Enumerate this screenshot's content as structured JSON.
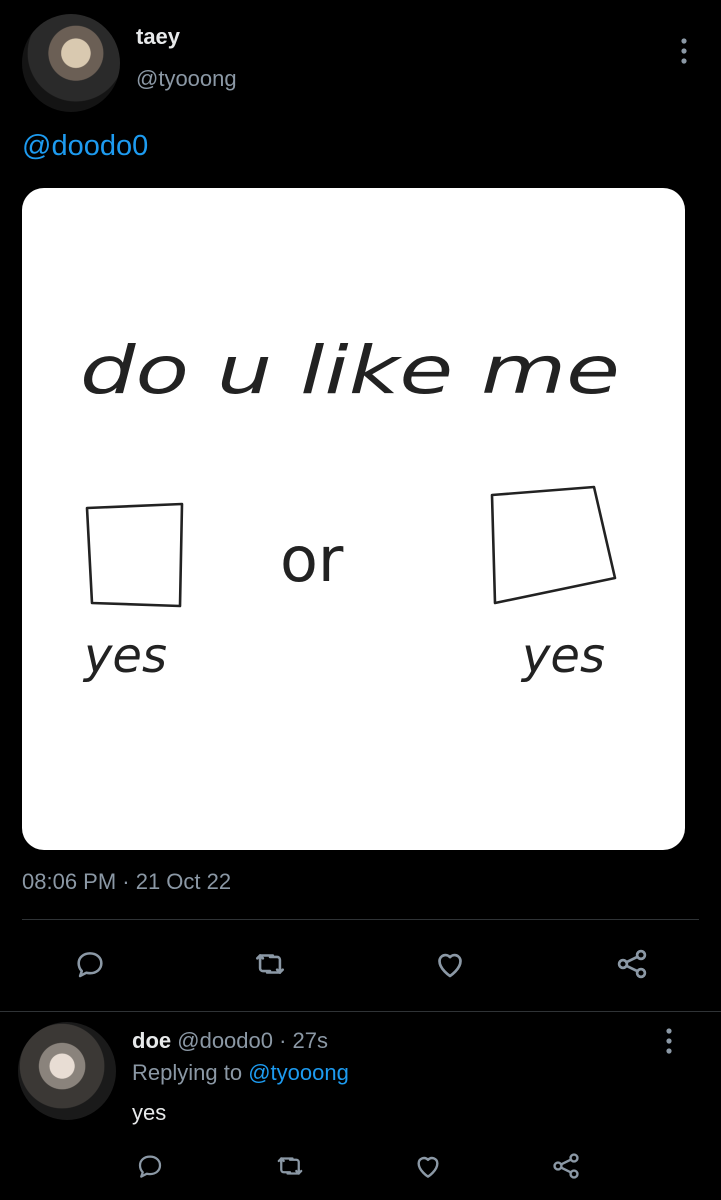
{
  "tweet": {
    "display_name": "taey",
    "handle": "@tyooong",
    "text": "@doodo0",
    "image_text": [
      "do u like me",
      "or",
      "yes",
      "yes"
    ],
    "timestamp": "08:06 PM · 21 Oct 22",
    "actions": [
      "reply-icon",
      "retweet-icon",
      "like-icon",
      "share-icon"
    ]
  },
  "reply": {
    "display_name": "doe",
    "handle_time": "@doodo0 · 27s",
    "replying_prefix": "Replying to",
    "replying_to": "@tyooong",
    "text": "yes"
  },
  "colors": {
    "background": "#000000",
    "link": "#1d9bf0",
    "secondary_text": "#8b98a5",
    "primary_text": "#e7e9ea"
  }
}
